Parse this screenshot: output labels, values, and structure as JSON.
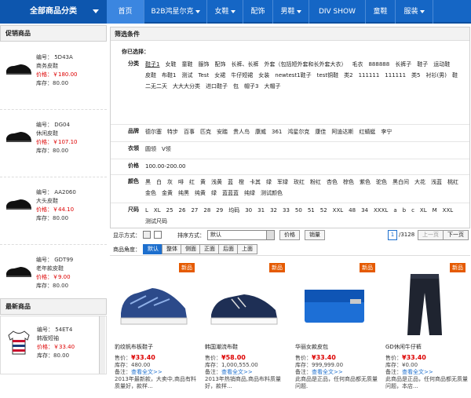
{
  "nav": {
    "all_categories": "全部商品分类",
    "items": [
      {
        "label": "首页",
        "dd": false
      },
      {
        "label": "B2B鸿星尔克",
        "dd": true
      },
      {
        "label": "女鞋",
        "dd": true
      },
      {
        "label": "配饰",
        "dd": false
      },
      {
        "label": "男鞋",
        "dd": true
      },
      {
        "label": "DIV SHOW",
        "dd": false
      },
      {
        "label": "童鞋",
        "dd": false
      },
      {
        "label": "服装",
        "dd": true
      }
    ]
  },
  "left": {
    "promo_title": "促销商品",
    "promo": [
      {
        "code": "编号：  5D43A",
        "name": "商务皮鞋",
        "price": "价格：￥180.00",
        "stock": "库存：80.00"
      },
      {
        "code": "编号：  DG04",
        "name": "休闲皮鞋",
        "price": "价格：￥107.10",
        "stock": "库存：80.00"
      },
      {
        "code": "编号：  AA2060",
        "name": "大头皮鞋",
        "price": "价格：￥44.10",
        "stock": "库存：80.00"
      },
      {
        "code": "编号：  GDT99",
        "name": "老年款皮鞋",
        "price": "价格：￥9.00",
        "stock": "库存：80.00"
      }
    ],
    "new_title": "最新商品",
    "newest": {
      "code": "编号：  54ET4",
      "name": "韩版短袖",
      "price": "价格：￥33.40",
      "stock": "库存：80.00"
    }
  },
  "filter": {
    "title": "筛选条件",
    "selected_label": "你已选择：",
    "rows": [
      {
        "label": "分类",
        "opts": [
          "鞋子1",
          "女鞋",
          "童鞋",
          "服饰",
          "配饰",
          "长裤、长裤",
          "外套（包括短外套和长外套大衣）",
          "毛衣",
          "888888",
          "长裤子",
          "鞋子",
          "运动鞋",
          "皮鞋",
          "布鞋1",
          "测试",
          "Test",
          "女裙",
          "牛仔短裙",
          "女装",
          "newtest1鞋子",
          "test铜鞋",
          "类2",
          "111111",
          "111111",
          "类5",
          "衬衫(男)",
          "鞋",
          "二无二天",
          "大大大分类",
          "进口鞋子",
          "包",
          "帽子3",
          "大帽子"
        ]
      },
      {
        "label": "品牌",
        "opts": [
          "德尔塞",
          "特步",
          "百事",
          "匹克",
          "安踏",
          "贵人鸟",
          "康威",
          "361",
          "鸿星尔克",
          "康佳",
          "阿迪达斯",
          "红蜻蜓",
          "李宁"
        ]
      },
      {
        "label": "衣领",
        "opts": [
          "圆领",
          "V领"
        ]
      },
      {
        "label": "价格",
        "opts": [
          "100.00-200.00"
        ]
      },
      {
        "label": "颜色",
        "opts": [
          "黑",
          "白",
          "灰",
          "啡",
          "红",
          "黄",
          "浅黄",
          "蓝",
          "橙",
          "卡其",
          "绿",
          "军绿",
          "玫红",
          "粉红",
          "杏色",
          "棕色",
          "紫色",
          "驼色",
          "黑白间",
          "大花",
          "浅蓝",
          "桃红",
          "金色",
          "金黄",
          "纯黑",
          "纯黄",
          "绿",
          "蓝蓝蓝",
          "纯绿",
          "测试颜色"
        ]
      },
      {
        "label": "尺码",
        "opts": [
          "L",
          "XL",
          "25",
          "26",
          "27",
          "28",
          "29",
          "均码",
          "30",
          "31",
          "32",
          "33",
          "50",
          "51",
          "52",
          "XXL",
          "48",
          "34",
          "XXXL",
          "a",
          "b",
          "c",
          "XL",
          "M",
          "XXL",
          "测试尺码"
        ]
      }
    ]
  },
  "toolbar": {
    "display_label": "显示方式：",
    "sort_label": "排序方式：",
    "sort_value": "默认",
    "price_btn": "价格",
    "sales_btn": "销量",
    "page_current": "1",
    "page_total": "/3128",
    "prev": "上一页",
    "next": "下一页"
  },
  "angles": {
    "label": "商品角度：",
    "options": [
      "默认",
      "整体",
      "侧面",
      "正面",
      "后面",
      "上面"
    ]
  },
  "products": [
    {
      "badge": "新品",
      "title": "豹纹帆布板鞋子",
      "price": "¥33.40",
      "stock": "库存：480.00",
      "note_label": "备注：",
      "note": "查看全文>>",
      "desc": "2013年最新款，大卖中,商品有料质量好，款样..."
    },
    {
      "badge": "新品",
      "title": "韩国潮流布鞋",
      "price": "¥58.00",
      "stock": "库存：1,000,555.00",
      "note_label": "备注：",
      "note": "查看全文>>",
      "desc": "2013年热销商品,商品布料质量好，款样..."
    },
    {
      "badge": "新品",
      "title": "华丽女款皮包",
      "price": "¥33.40",
      "stock": "库存：999,999.00",
      "note_label": "备注：",
      "note": "查看全文>>",
      "desc": "此商品是正品，任何商品都无质量问题."
    },
    {
      "badge": "新品",
      "title": "GD休闲牛仔裤",
      "price": "¥33.40",
      "stock": "库存：¥0.00",
      "note_label": "备注：",
      "note": "查看全文>>",
      "desc": "此商品是正品，任何商品都无质量问题，本店..."
    }
  ]
}
